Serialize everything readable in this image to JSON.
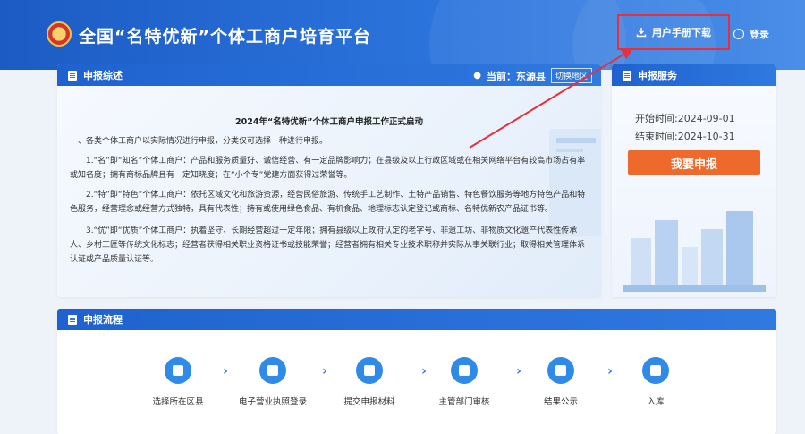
{
  "header": {
    "title": "全国“名特优新”个体工商户培育平台",
    "manual_download": "用户手册下载",
    "login": "登录"
  },
  "overview": {
    "title": "申报综述",
    "location_label": "当前：东源县",
    "switch_label": "切换地区",
    "notice_title": "2024年“名特优新”个体工商户申报工作正式启动",
    "paragraphs": [
      "一、各类个体工商户以实际情况进行申报，分类仅可选择一种进行申报。",
      "1.“名”即“知名”个体工商户：产品和服务质量好、诚信经营、有一定品牌影响力；在县级及以上行政区域或在相关网络平台有较高市场占有率或知名度；拥有商标品牌且有一定知晓度；在“小个专”党建方面获得过荣誉等。",
      "2.“特”即“特色”个体工商户：依托区域文化和旅游资源，经营民俗旅游、传统手工艺制作、土特产品销售、特色餐饮服务等地方特色产品和特色服务，经营理念或经营方式独特，具有代表性；持有或使用绿色食品、有机食品、地理标志认定登记或商标、名特优新农产品证书等。",
      "3.“优”即“优质”个体工商户：执着坚守、长期经营超过一定年限；拥有县级以上政府认定的老字号、非遗工坊、非物质文化遗产代表性传承人、乡村工匠等传统文化标志；经营者获得相关职业资格证书或技能荣誉；经营者拥有相关专业技术职称并实际从事关联行业；取得相关管理体系认证或产品质量认证等。"
    ]
  },
  "service": {
    "title": "申报服务",
    "start_time": "开始时间:2024-09-01",
    "end_time": "结束时间:2024-10-31",
    "apply_button": "我要申报"
  },
  "process": {
    "title": "申报流程",
    "steps": [
      {
        "label": "选择所在区县",
        "icon": "enter-icon"
      },
      {
        "label": "电子营业执照登录",
        "icon": "user-key-icon"
      },
      {
        "label": "提交申报材料",
        "icon": "edit-doc-icon"
      },
      {
        "label": "主管部门审核",
        "icon": "review-icon"
      },
      {
        "label": "结果公示",
        "icon": "publish-icon"
      },
      {
        "label": "入库",
        "icon": "storage-icon"
      }
    ]
  },
  "colors": {
    "header_blue": "#1c5bc4",
    "accent_orange": "#ee6a2c",
    "highlight_red": "#e8303a"
  }
}
